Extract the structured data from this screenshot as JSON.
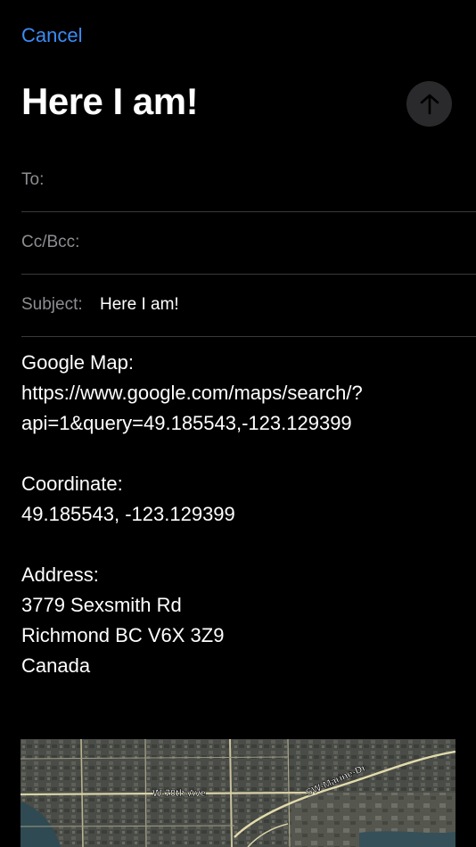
{
  "nav": {
    "cancel_label": "Cancel"
  },
  "compose": {
    "title": "Here I am!",
    "send_icon": "arrow-up-icon"
  },
  "fields": {
    "to_label": "To:",
    "cc_bcc_label": "Cc/Bcc:",
    "subject_label": "Subject:",
    "subject_value": "Here I am!"
  },
  "message": {
    "google_map_label": "Google Map:",
    "google_map_url_line1": "https://www.google.com/maps/search/?",
    "google_map_url_line2": "api=1&query=49.185543,-123.129399",
    "coordinate_label": "Coordinate:",
    "coordinate_value": "49.185543, -123.129399",
    "address_label": "Address:",
    "address_line1": "3779 Sexsmith Rd",
    "address_line2": "Richmond BC V6X 3Z9",
    "address_line3": "Canada"
  },
  "map": {
    "street_1": "W-70th-Ave",
    "street_2": "SW-Marine-Dr"
  },
  "colors": {
    "accent": "#3b8cf5",
    "background": "#000000",
    "label_gray": "#8d8d92",
    "separator": "#3a3a3c"
  }
}
